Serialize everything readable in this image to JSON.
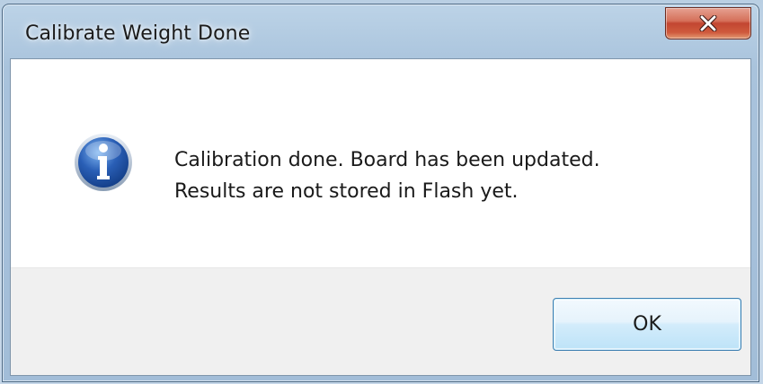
{
  "window": {
    "title": "Calibrate Weight Done"
  },
  "message": {
    "line1": "Calibration done. Board has been updated.",
    "line2": "Results are not stored in Flash yet."
  },
  "buttons": {
    "ok_label": "OK"
  },
  "icons": {
    "dialog_icon": "info-icon",
    "close": "close-icon"
  },
  "colors": {
    "close_button_red": "#c24631",
    "ok_button_border": "#3c7fb1",
    "info_icon_blue": "#2a5fb6",
    "button_area_bg": "#f0f0f0"
  }
}
